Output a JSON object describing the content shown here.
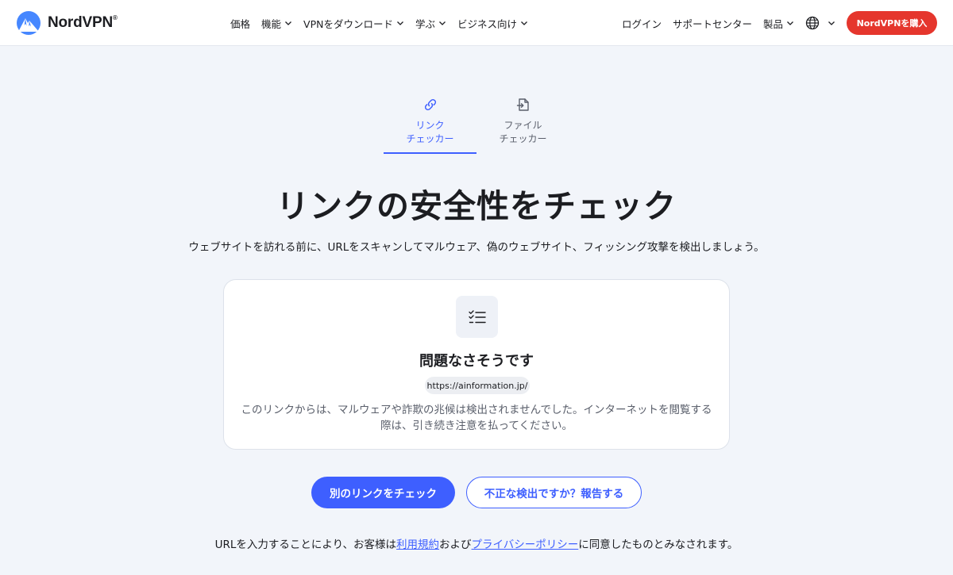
{
  "header": {
    "brand": "NordVPN",
    "brand_mark": "®",
    "nav": [
      {
        "label": "価格",
        "has_dropdown": false
      },
      {
        "label": "機能",
        "has_dropdown": true
      },
      {
        "label": "VPNをダウンロード",
        "has_dropdown": true
      },
      {
        "label": "学ぶ",
        "has_dropdown": true
      },
      {
        "label": "ビジネス向け",
        "has_dropdown": true
      }
    ],
    "login": "ログイン",
    "support": "サポートセンター",
    "products": "製品",
    "buy_button": "NordVPNを購入"
  },
  "tabs": [
    {
      "label": "リンク\nチェッカー",
      "active": true,
      "icon": "link-icon"
    },
    {
      "label": "ファイル\nチェッカー",
      "active": false,
      "icon": "file-check-icon"
    }
  ],
  "hero": {
    "title": "リンクの安全性をチェック",
    "subtitle": "ウェブサイトを訪れる前に、URLをスキャンしてマルウェア、偽のウェブサイト、フィッシング攻撃を検出しましょう。"
  },
  "result": {
    "icon": "checklist-icon",
    "title": "問題なさそうです",
    "url": "https://ainformation.jp/",
    "description": "このリンクからは、マルウェアや詐欺の兆候は検出されませんでした。インターネットを閲覧する際は、引き続き注意を払ってください。"
  },
  "actions": {
    "check_another": "別のリンクをチェック",
    "report": "不正な検出ですか？報告する"
  },
  "terms": {
    "prefix": "URLを入力することにより、お客様は",
    "terms_link": "利用規約",
    "middle": "および",
    "privacy_link": "プライバシーポリシー",
    "suffix": "に同意したものとみなされます。"
  },
  "colors": {
    "accent": "#3e5fff",
    "buy": "#e5362d",
    "background": "#f2f5fa"
  }
}
